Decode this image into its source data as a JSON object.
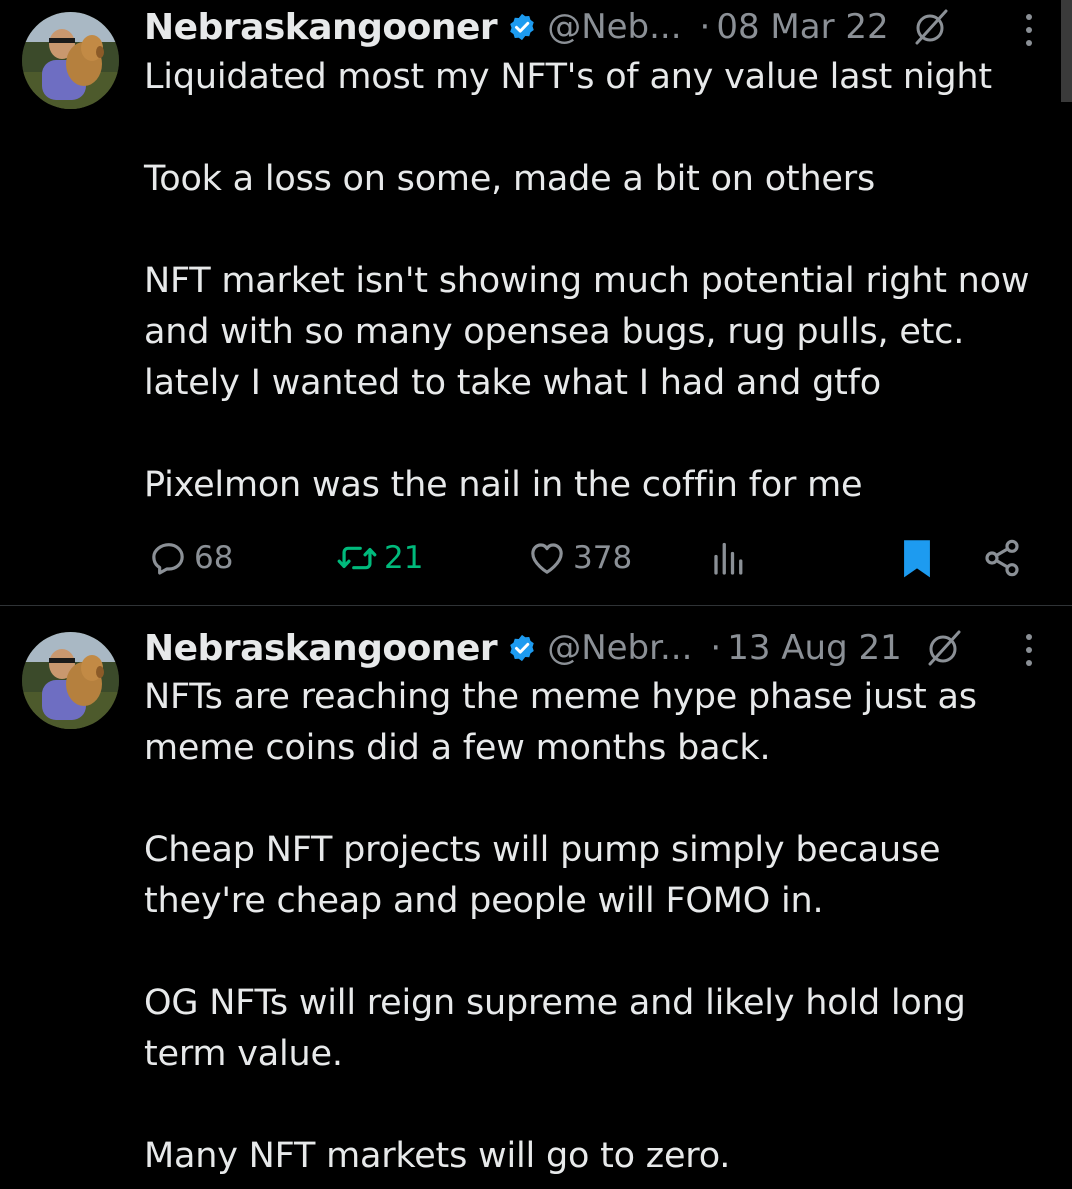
{
  "tweets": [
    {
      "author_name": "Nebraskangooner",
      "handle": "@Neb...",
      "separator": "·",
      "date": "08 Mar 22",
      "paragraphs": [
        "Liquidated most my NFT's of any value last night",
        "Took a loss on some, made a bit on others",
        "NFT market isn't showing much potential right now and with so many opensea bugs, rug pulls, etc. lately I wanted to take what I had and gtfo",
        "Pixelmon was the nail in the coffin for me"
      ],
      "stats": {
        "replies": "68",
        "retweets": "21",
        "likes": "378"
      },
      "bookmarked": true,
      "retweeted": true
    },
    {
      "author_name": "Nebraskangooner",
      "handle": "@Nebr...",
      "separator": "·",
      "date": "13 Aug 21",
      "paragraphs": [
        "NFTs are reaching the meme hype phase just as meme coins did a few months back.",
        "Cheap NFT projects will pump simply because they're cheap and people will FOMO in.",
        "OG NFTs will reign supreme and likely hold long term value.",
        "Many NFT markets will go to zero."
      ]
    }
  ],
  "icons": {
    "verified": "verified-badge-icon",
    "grok": "grok-icon",
    "more": "more-options-icon",
    "reply": "reply-icon",
    "retweet": "retweet-icon",
    "like": "heart-icon",
    "views": "views-chart-icon",
    "bookmark": "bookmark-icon",
    "share": "share-icon"
  },
  "colors": {
    "background": "#000000",
    "text": "#e7e9ea",
    "secondary_text": "#8b9096",
    "verified_blue": "#1d9bf0",
    "retweet_green": "#00ba7c",
    "divider": "#2f3336"
  }
}
